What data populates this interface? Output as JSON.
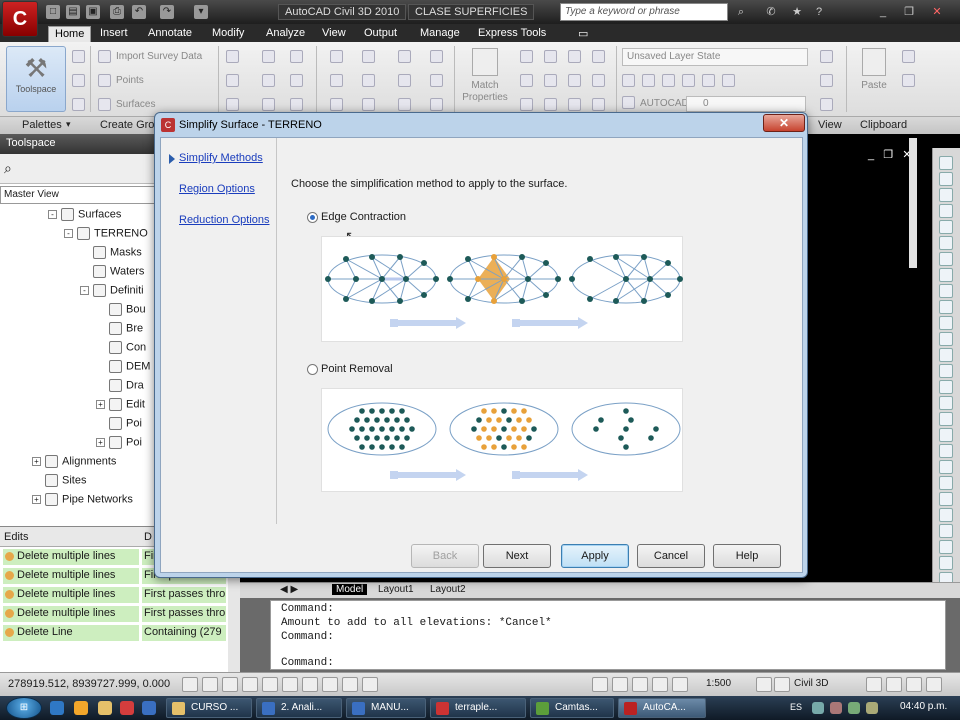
{
  "window": {
    "app_title": "AutoCAD Civil 3D 2010",
    "doc_title": "CLASE SUPERFICIES",
    "search_placeholder": "Type a keyword or phrase"
  },
  "ribbon": {
    "tabs": [
      "Home",
      "Insert",
      "Annotate",
      "Modify",
      "Analyze",
      "View",
      "Output",
      "Manage",
      "Express Tools"
    ],
    "active_tab": "Home",
    "toolspace_label": "Toolspace",
    "ground_data": [
      "Import Survey Data",
      "Points",
      "Surfaces"
    ],
    "match_properties": "Match Properties",
    "layer_state": "Unsaved Layer State",
    "autocad_label": "AUTOCAD",
    "layer_value": "0",
    "paste_label": "Paste",
    "panels": [
      "Palettes",
      "Create Gro",
      "View",
      "Clipboard"
    ]
  },
  "toolspace": {
    "title": "Toolspace",
    "master_view": "Master View",
    "tree": [
      {
        "label": "Surfaces",
        "level": 3,
        "exp": "-"
      },
      {
        "label": "TERRENO",
        "level": 4,
        "exp": "-"
      },
      {
        "label": "Masks",
        "level": 5,
        "exp": ""
      },
      {
        "label": "Waters",
        "level": 5,
        "exp": ""
      },
      {
        "label": "Definiti",
        "level": 5,
        "exp": "-"
      },
      {
        "label": "Bou",
        "level": 6,
        "exp": ""
      },
      {
        "label": "Bre",
        "level": 6,
        "exp": ""
      },
      {
        "label": "Con",
        "level": 6,
        "exp": ""
      },
      {
        "label": "DEM",
        "level": 6,
        "exp": ""
      },
      {
        "label": "Dra",
        "level": 6,
        "exp": ""
      },
      {
        "label": "Edit",
        "level": 6,
        "exp": "+"
      },
      {
        "label": "Poi",
        "level": 6,
        "exp": ""
      },
      {
        "label": "Poi",
        "level": 6,
        "exp": "+"
      },
      {
        "label": "Alignments",
        "level": 2,
        "exp": "+"
      },
      {
        "label": "Sites",
        "level": 2,
        "exp": ""
      },
      {
        "label": "Pipe Networks",
        "level": 2,
        "exp": "+"
      }
    ]
  },
  "edits": {
    "columns": [
      "Edits",
      "D"
    ],
    "rows": [
      {
        "edit": "Delete multiple lines",
        "desc": "First passes thro"
      },
      {
        "edit": "Delete multiple lines",
        "desc": "First passes thro"
      },
      {
        "edit": "Delete multiple lines",
        "desc": "First passes thro"
      },
      {
        "edit": "Delete multiple lines",
        "desc": "First passes thro"
      },
      {
        "edit": "Delete Line",
        "desc": "Containing (279"
      }
    ]
  },
  "dialog": {
    "title": "Simplify Surface - TERRENO",
    "nav": [
      "Simplify Methods",
      "Region Options",
      "Reduction Options"
    ],
    "instruction": "Choose the simplification method to apply to the surface.",
    "options": [
      {
        "label": "Edge Contraction",
        "selected": true
      },
      {
        "label": "Point Removal",
        "selected": false
      }
    ],
    "buttons": {
      "back": "Back",
      "next": "Next",
      "apply": "Apply",
      "cancel": "Cancel",
      "help": "Help"
    }
  },
  "layout_tabs": [
    "Model",
    "Layout1",
    "Layout2"
  ],
  "command_lines": [
    "Command:",
    "Amount to add to all elevations: *Cancel*",
    "Command:",
    "",
    "Command:"
  ],
  "status": {
    "coords": "278919.512, 8939727.999, 0.000",
    "scale": "1:500",
    "workspace": "Civil 3D"
  },
  "taskbar": {
    "start": "Start",
    "tasks": [
      "CURSO ...",
      "2. Anali...",
      "MANU...",
      "terraple...",
      "Camtas...",
      "AutoCA..."
    ],
    "lang": "ES",
    "time": "04:40 p.m."
  },
  "colors": {
    "highlight": "#e8a13a",
    "node": "#1d5a58",
    "edge": "#7aa0c6",
    "arrow": "#c4d4f0"
  }
}
